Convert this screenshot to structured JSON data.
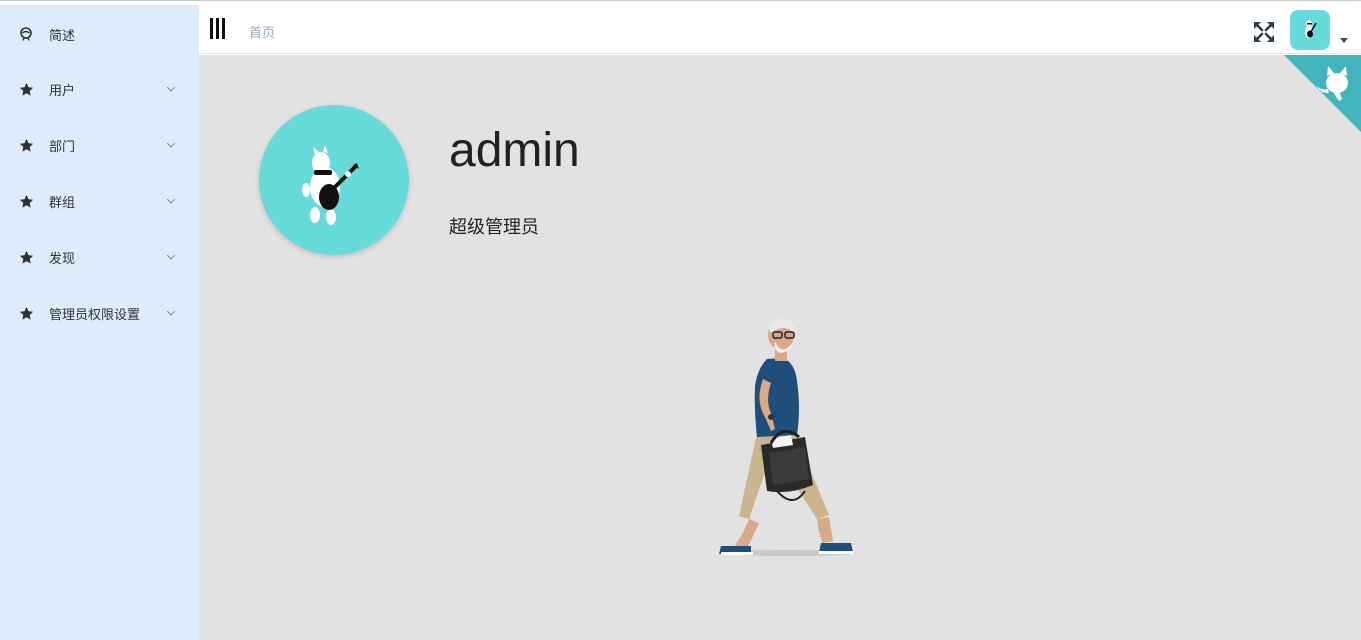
{
  "sidebar": {
    "items": [
      {
        "label": "简述",
        "icon": "dashboard-icon",
        "has_arrow": false
      },
      {
        "label": "用户",
        "icon": "star-icon",
        "has_arrow": true
      },
      {
        "label": "部门",
        "icon": "star-icon",
        "has_arrow": true
      },
      {
        "label": "群组",
        "icon": "star-icon",
        "has_arrow": true
      },
      {
        "label": "发现",
        "icon": "star-icon",
        "has_arrow": true
      },
      {
        "label": "管理员权限设置",
        "icon": "star-icon",
        "has_arrow": true
      }
    ]
  },
  "header": {
    "breadcrumb": "首页",
    "icons": [
      "hamburger-icon",
      "fullscreen-icon",
      "avatar",
      "caret-down-icon"
    ]
  },
  "profile": {
    "name": "admin",
    "role": "超级管理员"
  },
  "colors": {
    "sidebar_bg": "#deebfa",
    "main_bg": "#e2e2e2",
    "avatar_bg": "#67dbd9",
    "corner_bg": "#40b5bc"
  }
}
